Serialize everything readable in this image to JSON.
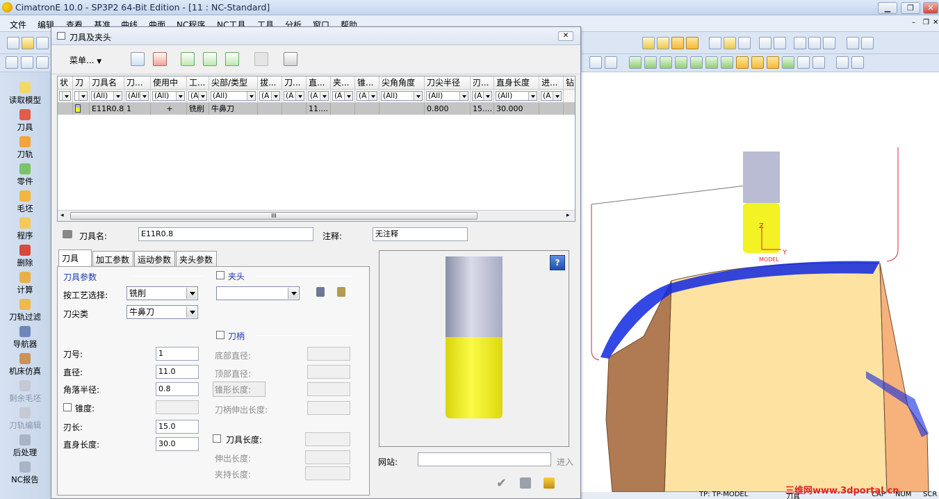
{
  "app": {
    "title": "CimatronE 10.0 - SP3P2 64-Bit Edition - [11 : NC-Standard]"
  },
  "menubar": [
    "文件",
    "编辑",
    "查看",
    "基准",
    "曲线",
    "曲面",
    "NC程序",
    "NC工具",
    "工具",
    "分析",
    "窗口",
    "帮助"
  ],
  "left_panel": [
    {
      "label": "读取模型",
      "icon": "read-model-icon",
      "disabled": false
    },
    {
      "label": "刀具",
      "icon": "tool-icon",
      "disabled": false
    },
    {
      "label": "刀轨",
      "icon": "toolpath-icon",
      "disabled": false
    },
    {
      "label": "零件",
      "icon": "part-icon",
      "disabled": false
    },
    {
      "label": "毛坯",
      "icon": "stock-icon",
      "disabled": false
    },
    {
      "label": "程序",
      "icon": "procedure-icon",
      "disabled": false
    },
    {
      "label": "删除",
      "icon": "delete-icon",
      "disabled": false
    },
    {
      "label": "计算",
      "icon": "compute-icon",
      "disabled": false
    },
    {
      "label": "刀轨过滤",
      "icon": "toolpath-filter-icon",
      "disabled": false
    },
    {
      "label": "导航器",
      "icon": "navigator-icon",
      "disabled": false
    },
    {
      "label": "机床仿真",
      "icon": "machine-sim-icon",
      "disabled": false
    },
    {
      "label": "剩余毛坯",
      "icon": "remaining-stock-icon",
      "disabled": true
    },
    {
      "label": "刀轨编辑",
      "icon": "toolpath-edit-icon",
      "disabled": true
    },
    {
      "label": "后处理",
      "icon": "post-process-icon",
      "disabled": false
    },
    {
      "label": "NC报告",
      "icon": "nc-report-icon",
      "disabled": false
    }
  ],
  "dialog": {
    "title": "刀具及夹头",
    "menu_label": "菜单...",
    "columns": [
      "状",
      "刀",
      "刀具名",
      "刀...",
      "使用中",
      "工...",
      "尖部/类型",
      "拔...",
      "刀...",
      "直...",
      "夹...",
      "锥...",
      "尖角角度",
      "刀尖半径",
      "刃...",
      "直身长度",
      "进...",
      "钻"
    ],
    "filters": [
      "",
      "",
      "(All)",
      "(All)",
      "(All)",
      "(A",
      "(All)",
      "(A",
      "(A",
      "(A",
      "(A",
      "(A",
      "(All)",
      "(All)",
      "(A",
      "(All)",
      "(A",
      ""
    ],
    "row": [
      "",
      "",
      "E11R0.8",
      "1",
      "+",
      "铣削",
      "牛鼻刀",
      "",
      "",
      "11....",
      "",
      "",
      "",
      "0.800",
      "15....",
      "30.000",
      "",
      ""
    ],
    "scroll_grip": "III",
    "tool_name_label": "刀具名:",
    "tool_name_value": "E11R0.8",
    "comment_label": "注释:",
    "comment_value": "无注释",
    "tabs": [
      "刀具",
      "加工参数",
      "运动参数",
      "夹头参数"
    ],
    "tool_params_title": "刀具参数",
    "process_label": "按工艺选择:",
    "process_value": "铣削",
    "tip_type_label": "刀尖类",
    "tip_type_value": "牛鼻刀",
    "tool_no_label": "刀号:",
    "tool_no_value": "1",
    "diameter_label": "直径:",
    "diameter_value": "11.0",
    "corner_label": "角落半径:",
    "corner_value": "0.8",
    "taper_label": "锥度:",
    "taper_value": "",
    "flute_label": "刃长:",
    "flute_value": "15.0",
    "shank_label": "直身长度:",
    "shank_value": "30.0",
    "holder_label": "夹头",
    "holder_value": "",
    "arbor_label": "刀柄",
    "bottom_dia_label": "底部直径:",
    "top_dia_label": "顶部直径:",
    "cone_len_label": "锥形长度:",
    "arbor_ext_label": "刀柄伸出长度:",
    "tool_length_label": "刀具长度:",
    "extension_label": "伸出长度:",
    "gripping_label": "夹持长度:",
    "website_label": "网站:",
    "website_value": "",
    "go_label": "进入",
    "help_label": "?"
  },
  "viewport": {
    "axis_z": "Z",
    "axis_y": "Y",
    "axis_model": "MODEL",
    "status": [
      "TP: TP-MODEL",
      "刀具",
      "CAP",
      "NUM",
      "SCR"
    ]
  },
  "watermark": "三维网www.3dportal.cn",
  "colors": {
    "tool_yellow": "#f2f224",
    "tool_shank": "#b9bcd2",
    "part_face": "#fde2a2",
    "part_side": "#b07a52",
    "toolpath_blue": "#1028e0",
    "accent_red": "#e0242c"
  }
}
